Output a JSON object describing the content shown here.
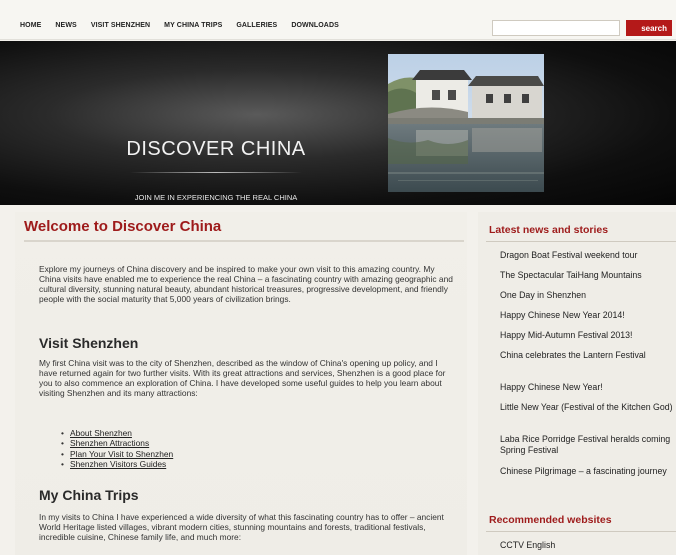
{
  "nav": {
    "items": [
      "HOME",
      "NEWS",
      "VISIT SHENZHEN",
      "MY CHINA TRIPS",
      "GALLERIES",
      "DOWNLOADS"
    ]
  },
  "search": {
    "value": "",
    "button_label": "search"
  },
  "banner": {
    "title": "DISCOVER CHINA",
    "subtitle": "JOIN ME IN EXPERIENCING THE REAL CHINA"
  },
  "main": {
    "welcome_title": "Welcome to Discover China",
    "intro": "Explore my journeys of China discovery and be inspired to make your own visit to this amazing country. My China visits have enabled me to experience the real China – a fascinating country with amazing geographic and cultural diversity, stunning natural beauty, abundant historical treasures, progressive development, and friendly people with the social maturity that 5,000 years of civilization brings.",
    "visit_heading": "Visit Shenzhen",
    "visit_text": "My first China visit was to the city of Shenzhen, described as the window of China's opening up policy, and I have returned again for two further visits. With its great attractions and services, Shenzhen is a good place for you to also commence an exploration of China. I have developed some useful guides to help you learn about visiting Shenzhen and its many attractions:",
    "visit_links": [
      "About Shenzhen",
      "Shenzhen Attractions",
      "Plan Your Visit to Shenzhen",
      "Shenzhen Visitors Guides"
    ],
    "trips_heading": "My China Trips",
    "trips_text": "In my visits to China I have experienced a wide diversity of what this fascinating country has to offer – ancient World Heritage listed villages, vibrant modern cities, stunning mountains and forests, traditional festivals, incredible cuisine, Chinese family life, and much more:"
  },
  "sidebar": {
    "news_heading": "Latest news and stories",
    "news_items": [
      "Dragon Boat Festival weekend tour",
      "The Spectacular TaiHang Mountains",
      "One Day in Shenzhen",
      "Happy Chinese New Year 2014!",
      "Happy Mid-Autumn Festival 2013!",
      "China celebrates the Lantern Festival",
      "Happy Chinese New Year!",
      "Little New Year (Festival of the Kitchen God)",
      "Laba Rice Porridge Festival heralds coming Spring Festival",
      "Chinese Pilgrimage – a fascinating journey"
    ],
    "websites_heading": "Recommended websites",
    "website_items": [
      "CCTV English"
    ]
  },
  "colors": {
    "accent": "#9e1b1b",
    "search_button": "#b41919",
    "banner_bg": "#111111"
  }
}
